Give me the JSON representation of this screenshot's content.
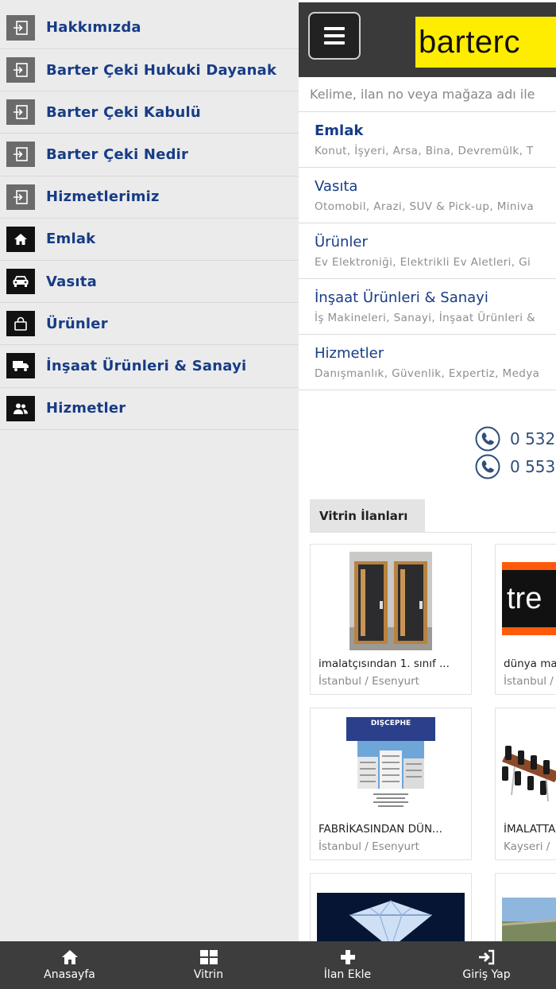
{
  "sidebar": {
    "items": [
      {
        "label": "Hakkımızda",
        "icon": "login-arrow-icon"
      },
      {
        "label": "Barter Çeki Hukuki Dayanak",
        "icon": "login-arrow-icon"
      },
      {
        "label": "Barter Çeki Kabulü",
        "icon": "login-arrow-icon"
      },
      {
        "label": "Barter Çeki Nedir",
        "icon": "login-arrow-icon"
      },
      {
        "label": "Hizmetlerimiz",
        "icon": "login-arrow-icon"
      },
      {
        "label": "Emlak",
        "icon": "home-icon"
      },
      {
        "label": "Vasıta",
        "icon": "car-icon"
      },
      {
        "label": "Ürünler",
        "icon": "shopping-bag-icon"
      },
      {
        "label": "İnşaat Ürünleri & Sanayi",
        "icon": "truck-icon"
      },
      {
        "label": "Hizmetler",
        "icon": "users-icon"
      }
    ]
  },
  "header": {
    "logo_text": "barterc",
    "logo_color": "#ffed00"
  },
  "search": {
    "placeholder": "Kelime, ilan no veya mağaza adı ile"
  },
  "categories": [
    {
      "title": "Emlak",
      "subtitle": "Konut, İşyeri, Arsa, Bina, Devremülk, T"
    },
    {
      "title": "Vasıta",
      "subtitle": "Otomobil, Arazi, SUV & Pick-up, Miniva"
    },
    {
      "title": "Ürünler",
      "subtitle": "Ev Elektroniği, Elektrikli Ev Aletleri, Gi"
    },
    {
      "title": "İnşaat Ürünleri & Sanayi",
      "subtitle": "İş Makineleri, Sanayi, İnşaat Ürünleri &"
    },
    {
      "title": "Hizmetler",
      "subtitle": "Danışmanlık, Güvenlik, Expertiz, Medya"
    }
  ],
  "phones": [
    "0 532",
    "0 553"
  ],
  "vitrin": {
    "tab_label": "Vitrin İlanları",
    "cards": [
      {
        "title": "imalatçısından 1. sınıf ...",
        "location": "İstanbul / Esenyurt"
      },
      {
        "title": "dünya ma",
        "location": "İstanbul /"
      },
      {
        "title": "FABRİKASINDAN DÜN...",
        "location": "İstanbul / Esenyurt"
      },
      {
        "title": "İMALATTA",
        "location": "Kayseri /"
      },
      {
        "title": "",
        "location": ""
      },
      {
        "title": "",
        "location": ""
      }
    ],
    "image_texts": {
      "tre": "tre",
      "discephe": "DIŞCEPHE"
    }
  },
  "bottom_nav": [
    {
      "label": "Anasayfa",
      "icon": "home-icon"
    },
    {
      "label": "Vitrin",
      "icon": "grid-icon"
    },
    {
      "label": "İlan Ekle",
      "icon": "plus-icon"
    },
    {
      "label": "Giriş Yap",
      "icon": "sign-in-icon"
    }
  ]
}
